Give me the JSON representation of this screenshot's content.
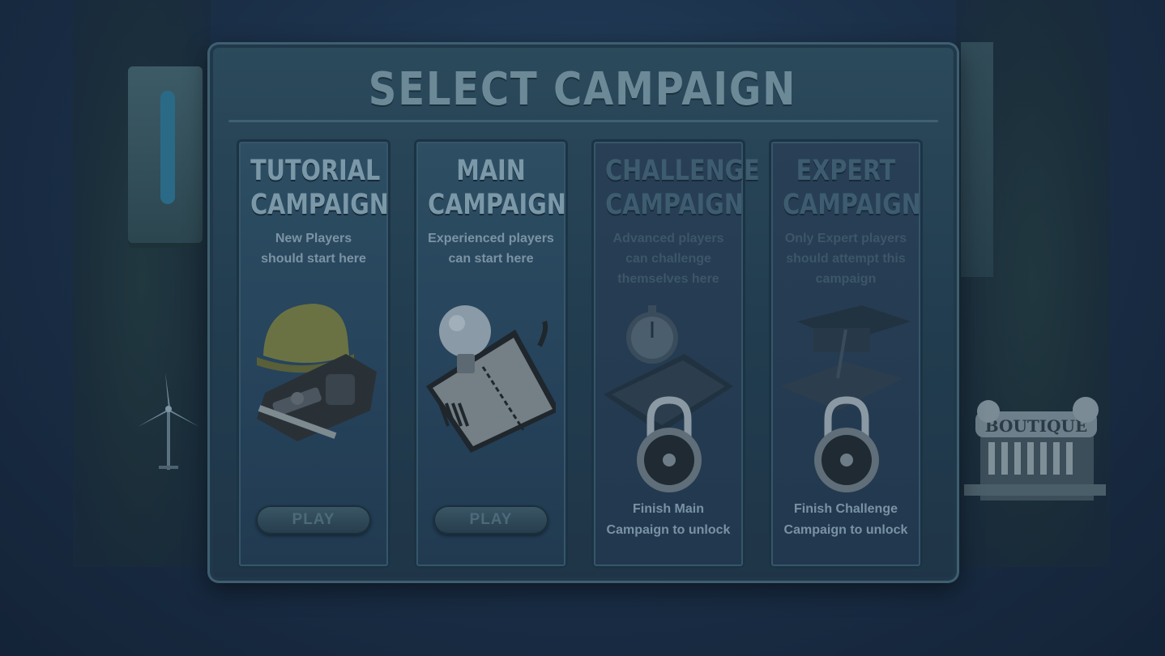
{
  "dialog": {
    "title": "SELECT CAMPAIGN"
  },
  "campaigns": [
    {
      "title_line1": "TUTORIAL",
      "title_line2": "CAMPAIGN",
      "desc_line1": "New Players",
      "desc_line2": "should start here",
      "desc_line3": "",
      "button": "PLAY",
      "locked": false,
      "art_icon": "hardhat-toolbelt-icon"
    },
    {
      "title_line1": "MAIN",
      "title_line2": "CAMPAIGN",
      "desc_line1": "Experienced players",
      "desc_line2": "can start here",
      "desc_line3": "",
      "button": "PLAY",
      "locked": false,
      "art_icon": "lightbulb-planner-icon"
    },
    {
      "title_line1": "CHALLENGE",
      "title_line2": "CAMPAIGN",
      "desc_line1": "Advanced players",
      "desc_line2": "can challenge",
      "desc_line3": "themselves here",
      "unlock_line1": "Finish Main",
      "unlock_line2": "Campaign to unlock",
      "locked": true,
      "art_icon": "stopwatch-calculator-icon"
    },
    {
      "title_line1": "EXPERT",
      "title_line2": "CAMPAIGN",
      "desc_line1": "Only Expert players",
      "desc_line2": "should attempt this",
      "desc_line3": "campaign",
      "unlock_line1": "Finish Challenge",
      "unlock_line2": "Campaign to unlock",
      "locked": true,
      "art_icon": "graduation-cap-books-icon"
    }
  ],
  "background": {
    "shop_sign": "BOUTIQUE"
  },
  "colors": {
    "overlay": "#1b3049",
    "panel": "#2b4a5b",
    "title_text": "#6c8998",
    "card_text": "#7b98a8"
  }
}
